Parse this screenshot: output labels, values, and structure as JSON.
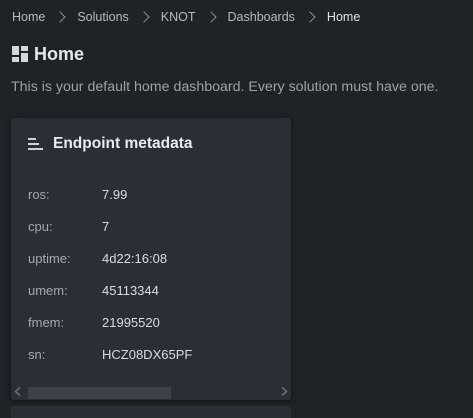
{
  "breadcrumb": {
    "items": [
      "Home",
      "Solutions",
      "KNOT",
      "Dashboards",
      "Home"
    ]
  },
  "header": {
    "icon": "dashboard-grid-icon",
    "title": "Home",
    "description": "This is your default home dashboard. Every solution must have one."
  },
  "card": {
    "icon": "list-lines-icon",
    "title": "Endpoint metadata",
    "rows": [
      {
        "key": "ros:",
        "value": "7.99"
      },
      {
        "key": "cpu:",
        "value": "7"
      },
      {
        "key": "uptime:",
        "value": "4d22:16:08"
      },
      {
        "key": "umem:",
        "value": "45113344"
      },
      {
        "key": "fmem:",
        "value": "21995520"
      },
      {
        "key": "sn:",
        "value": "HCZ08DX65PF"
      }
    ]
  },
  "colors": {
    "background": "#1f2327",
    "card": "#2a2f35",
    "text": "#c7ccd1"
  }
}
